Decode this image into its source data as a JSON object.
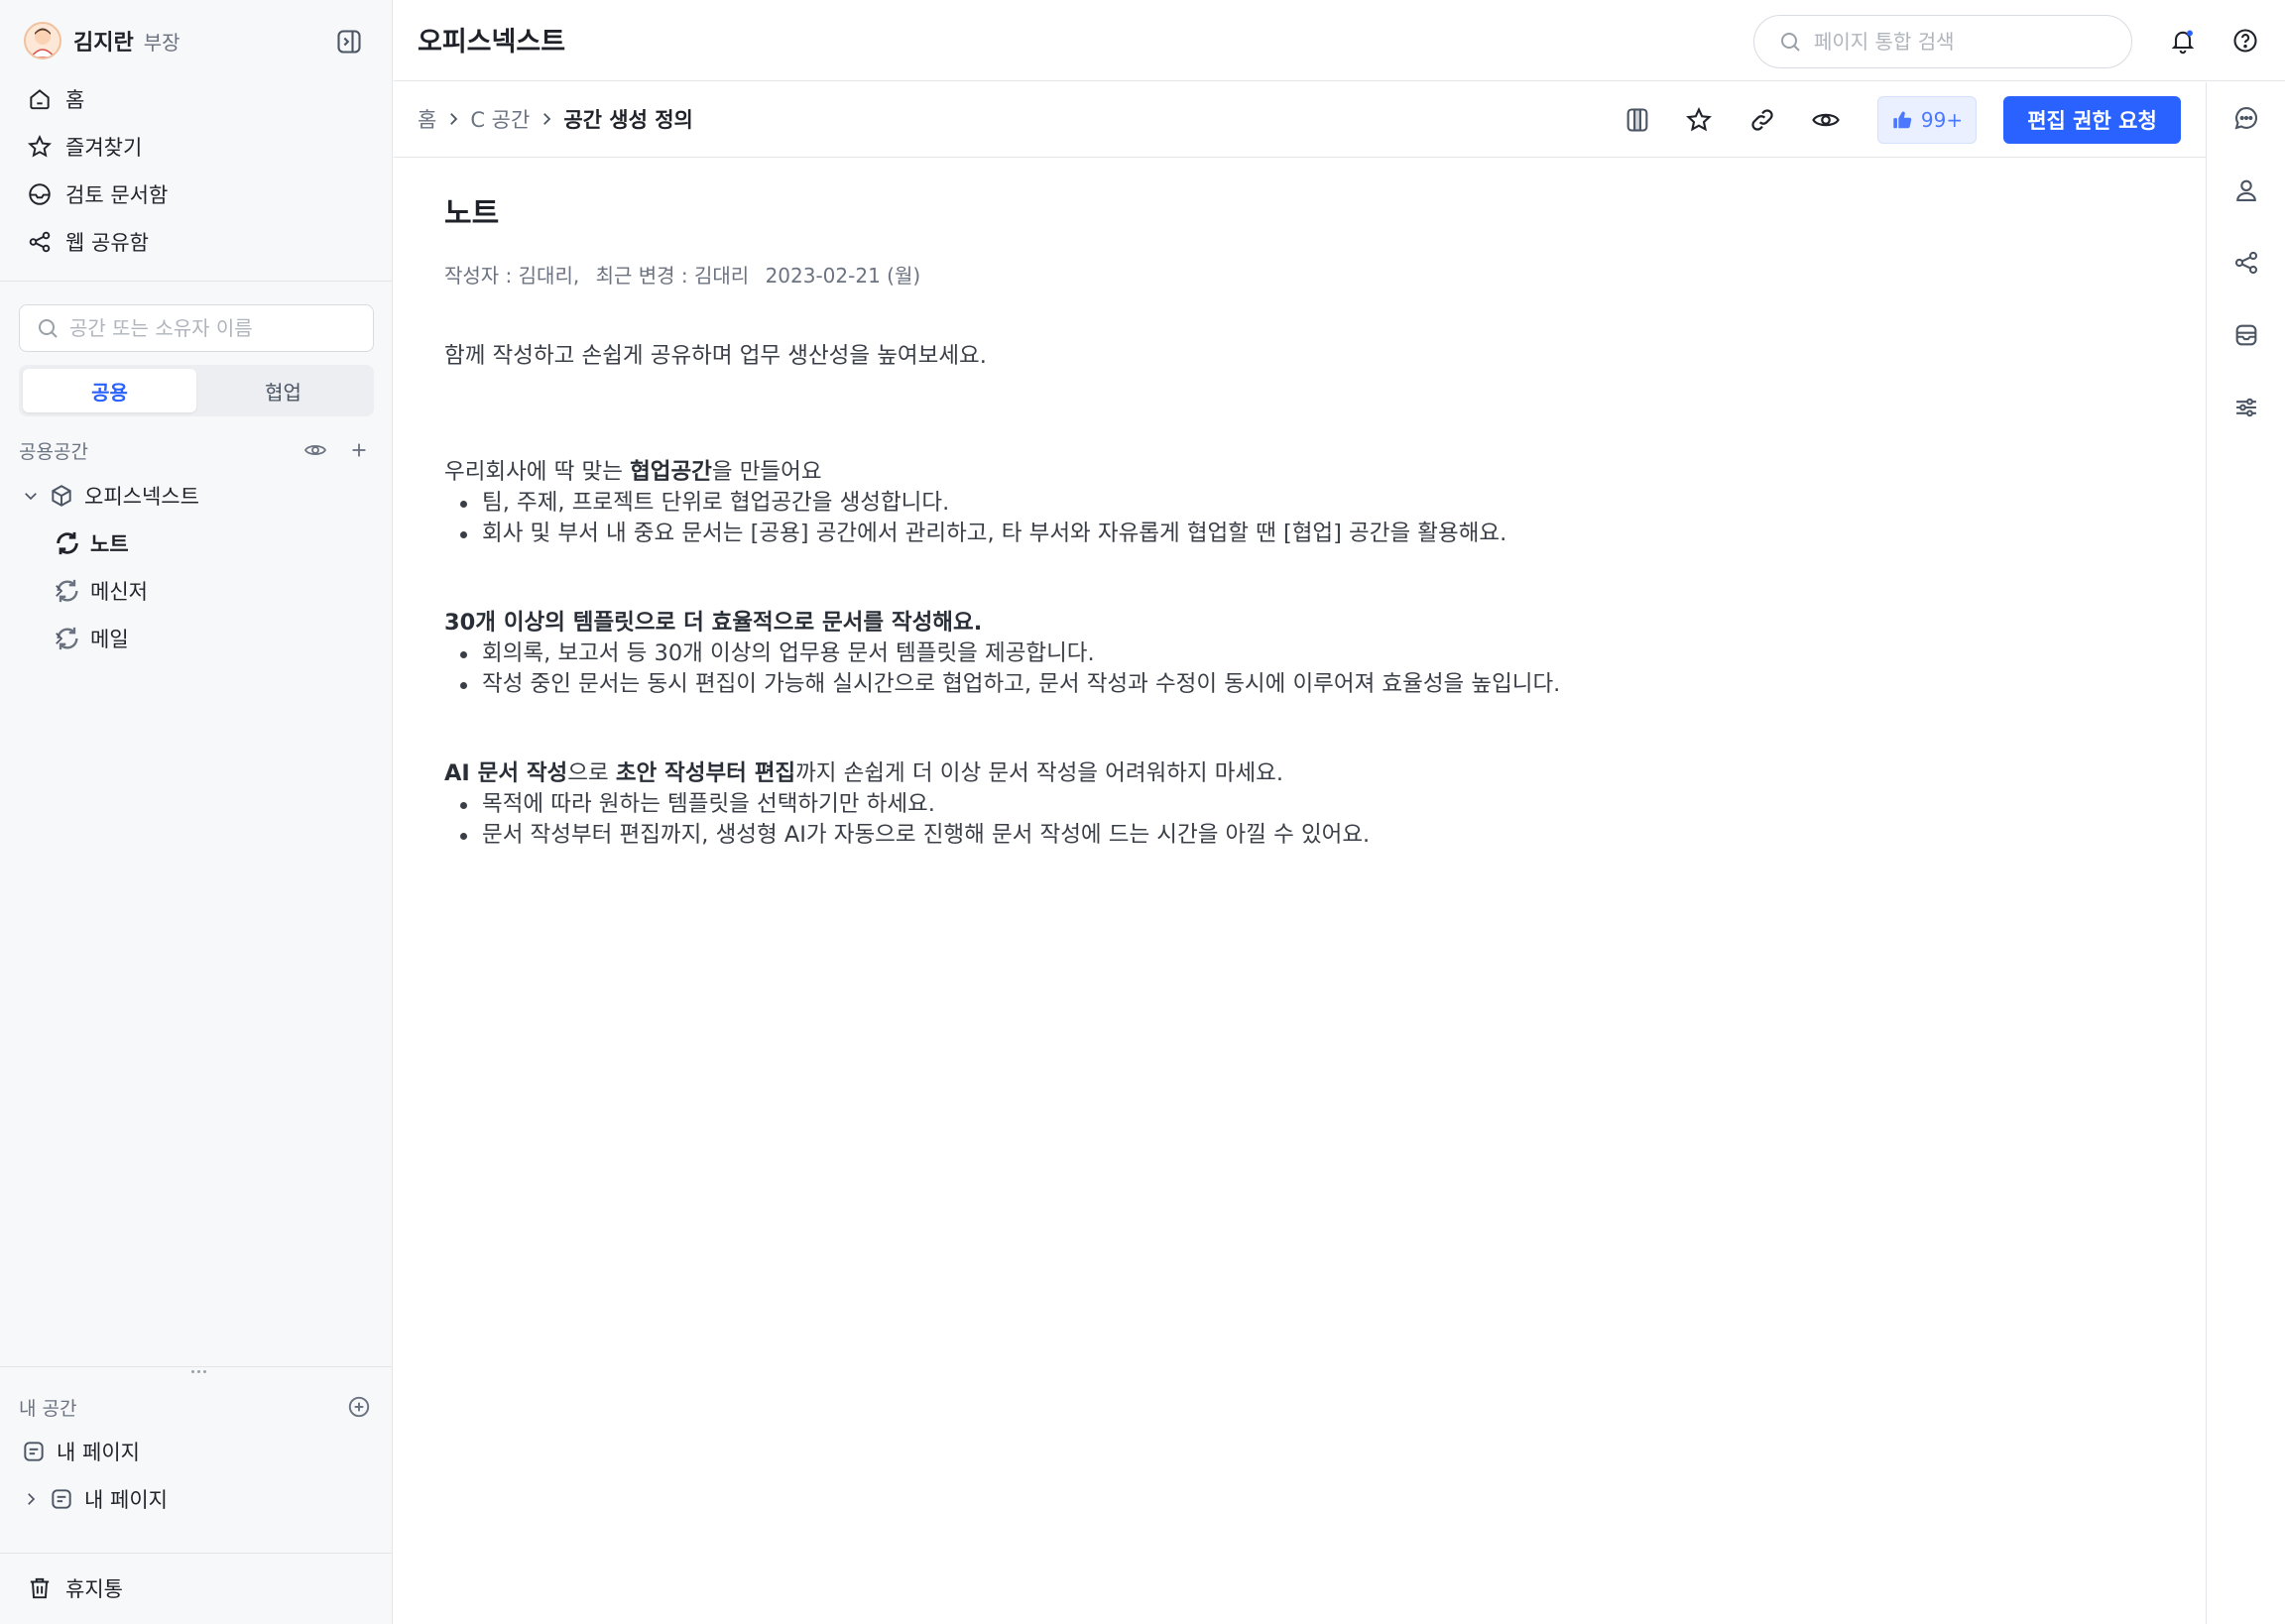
{
  "user": {
    "name": "김지란",
    "title": "부장"
  },
  "nav": [
    {
      "label": "홈",
      "icon": "home-icon"
    },
    {
      "label": "즐겨찾기",
      "icon": "star-icon"
    },
    {
      "label": "검토 문서함",
      "icon": "inbox-icon"
    },
    {
      "label": "웹 공유함",
      "icon": "share-icon"
    }
  ],
  "space_search": {
    "placeholder": "공간 또는 소유자 이름"
  },
  "tabs": {
    "public": "공용",
    "collab": "협업"
  },
  "public_space": {
    "title": "공용공간",
    "tree": [
      {
        "label": "오피스넥스트"
      },
      {
        "label": "노트"
      },
      {
        "label": "메신저"
      },
      {
        "label": "메일"
      }
    ]
  },
  "my_space": {
    "title": "내 공간",
    "items": [
      {
        "label": "내 페이지"
      },
      {
        "label": "내 페이지"
      }
    ]
  },
  "trash": {
    "label": "휴지통"
  },
  "header": {
    "title": "오피스넥스트",
    "search_placeholder": "페이지 통합 검색"
  },
  "breadcrumb": {
    "items": [
      "홈",
      "C 공간",
      "공간 생성 정의"
    ]
  },
  "toolbar": {
    "like_count": "99+",
    "request_label": "편집 권한 요청"
  },
  "document": {
    "title": "노트",
    "meta": {
      "author": "작성자 : 김대리,",
      "modified": "최근 변경 : 김대리",
      "date": "2023-02-21 (월)"
    },
    "intro": "함께 작성하고 손쉽게 공유하며 업무 생산성을 높여보세요.",
    "s1": {
      "pre": "우리회사에 딱 맞는 ",
      "bold": "협업공간",
      "post": "을 만들어요",
      "items": [
        "팀, 주제, 프로젝트 단위로 협업공간을 생성합니다.",
        "회사 및 부서 내 중요 문서는 [공용] 공간에서 관리하고, 타 부서와 자유롭게 협업할 땐 [협업] 공간을 활용해요."
      ]
    },
    "s2": {
      "bold": "30개 이상의 템플릿으로 더 효율적으로 문서를 작성해요.",
      "items": [
        "회의록, 보고서 등 30개 이상의 업무용 문서 템플릿을 제공합니다.",
        "작성 중인 문서는 동시 편집이 가능해 실시간으로 협업하고, 문서 작성과 수정이 동시에 이루어져 효율성을 높입니다."
      ]
    },
    "s3": {
      "bold1": "AI 문서 작성",
      "mid1": "으로 ",
      "bold2": "초안 작성부터 편집",
      "post": "까지 손쉽게 더 이상 문서 작성을 어려워하지 마세요.",
      "items": [
        "목적에 따라 원하는 템플릿을 선택하기만 하세요.",
        "문서 작성부터 편집까지, 생성형 AI가 자동으로 진행해 문서 작성에 드는 시간을 아낄 수 있어요."
      ]
    }
  },
  "colors": {
    "accent": "#2962ff",
    "like_bg": "#eaf0ff",
    "sidebar_bg": "#f7f8fa",
    "border": "#e3e5e8"
  }
}
